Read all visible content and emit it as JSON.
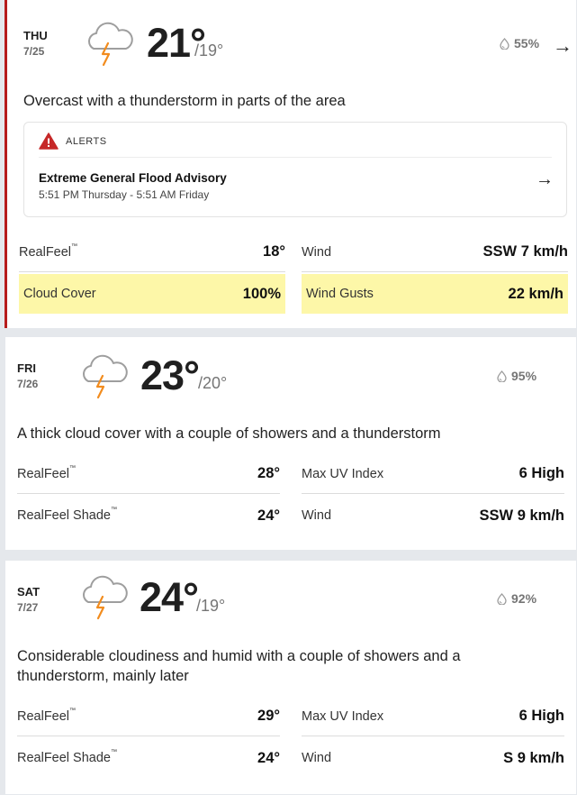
{
  "days": [
    {
      "day": "THU",
      "date": "7/25",
      "high": "21°",
      "low": "/19°",
      "precip": "55%",
      "has_arrow": true,
      "arrow": "→",
      "phrase": "Overcast with a thunderstorm in parts of the area",
      "alert": {
        "label": "ALERTS",
        "title": "Extreme General Flood Advisory",
        "time": "5:51 PM Thursday - 5:51 AM Friday",
        "arrow": "→"
      },
      "stats": [
        {
          "k": "RealFeel",
          "tm": "™",
          "v": "18°"
        },
        {
          "k": "Wind",
          "tm": "",
          "v": "SSW 7 km/h"
        },
        {
          "k": "Cloud Cover",
          "tm": "",
          "v": "100%"
        },
        {
          "k": "Wind Gusts",
          "tm": "",
          "v": "22 km/h"
        }
      ]
    },
    {
      "day": "FRI",
      "date": "7/26",
      "high": "23°",
      "low": "/20°",
      "precip": "95%",
      "phrase": "A thick cloud cover with a couple of showers and a thunderstorm",
      "stats": [
        {
          "k": "RealFeel",
          "tm": "™",
          "v": "28°"
        },
        {
          "k": "Max UV Index",
          "tm": "",
          "v": "6 High"
        },
        {
          "k": "RealFeel Shade",
          "tm": "™",
          "v": "24°"
        },
        {
          "k": "Wind",
          "tm": "",
          "v": "SSW 9 km/h"
        }
      ]
    },
    {
      "day": "SAT",
      "date": "7/27",
      "high": "24°",
      "low": "/19°",
      "precip": "92%",
      "phrase": "Considerable cloudiness and humid with a couple of showers and a thunderstorm, mainly later",
      "stats": [
        {
          "k": "RealFeel",
          "tm": "™",
          "v": "29°"
        },
        {
          "k": "Max UV Index",
          "tm": "",
          "v": "6 High"
        },
        {
          "k": "RealFeel Shade",
          "tm": "™",
          "v": "24°"
        },
        {
          "k": "Wind",
          "tm": "",
          "v": "S 9 km/h"
        }
      ]
    }
  ],
  "colors": {
    "alert_bar": "#b71c1c",
    "highlight": "#fdf7a8",
    "bolt": "#f28c1e",
    "cloud": "#9e9e9e"
  }
}
